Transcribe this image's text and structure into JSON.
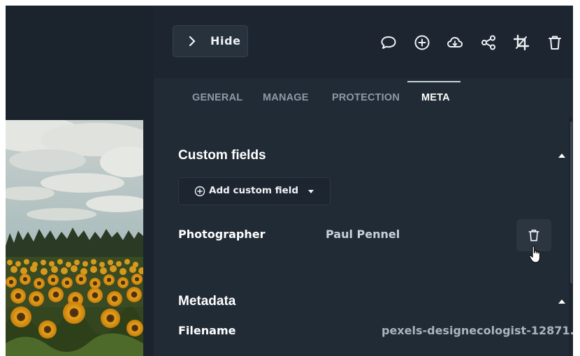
{
  "header": {
    "hide_label": "Hide",
    "toolbar_icons": [
      "comment-icon",
      "add-circle-icon",
      "cloud-download-icon",
      "share-icon",
      "crop-icon",
      "trash-icon"
    ]
  },
  "tabs": [
    {
      "label": "GENERAL",
      "active": false
    },
    {
      "label": "MANAGE",
      "active": false
    },
    {
      "label": "PROTECTION",
      "active": false
    },
    {
      "label": "META",
      "active": true
    }
  ],
  "custom_fields": {
    "title": "Custom fields",
    "add_label": "Add custom field",
    "items": [
      {
        "label": "Photographer",
        "value": "Paul Pennel"
      }
    ]
  },
  "metadata": {
    "title": "Metadata",
    "items": [
      {
        "label": "Filename",
        "value": "pexels-designecologist-12871..."
      }
    ]
  },
  "colors": {
    "panel_bg": "#212b35",
    "header_bg": "#1d2630",
    "text_primary": "#ffffff",
    "text_muted": "#8c9aa8"
  }
}
